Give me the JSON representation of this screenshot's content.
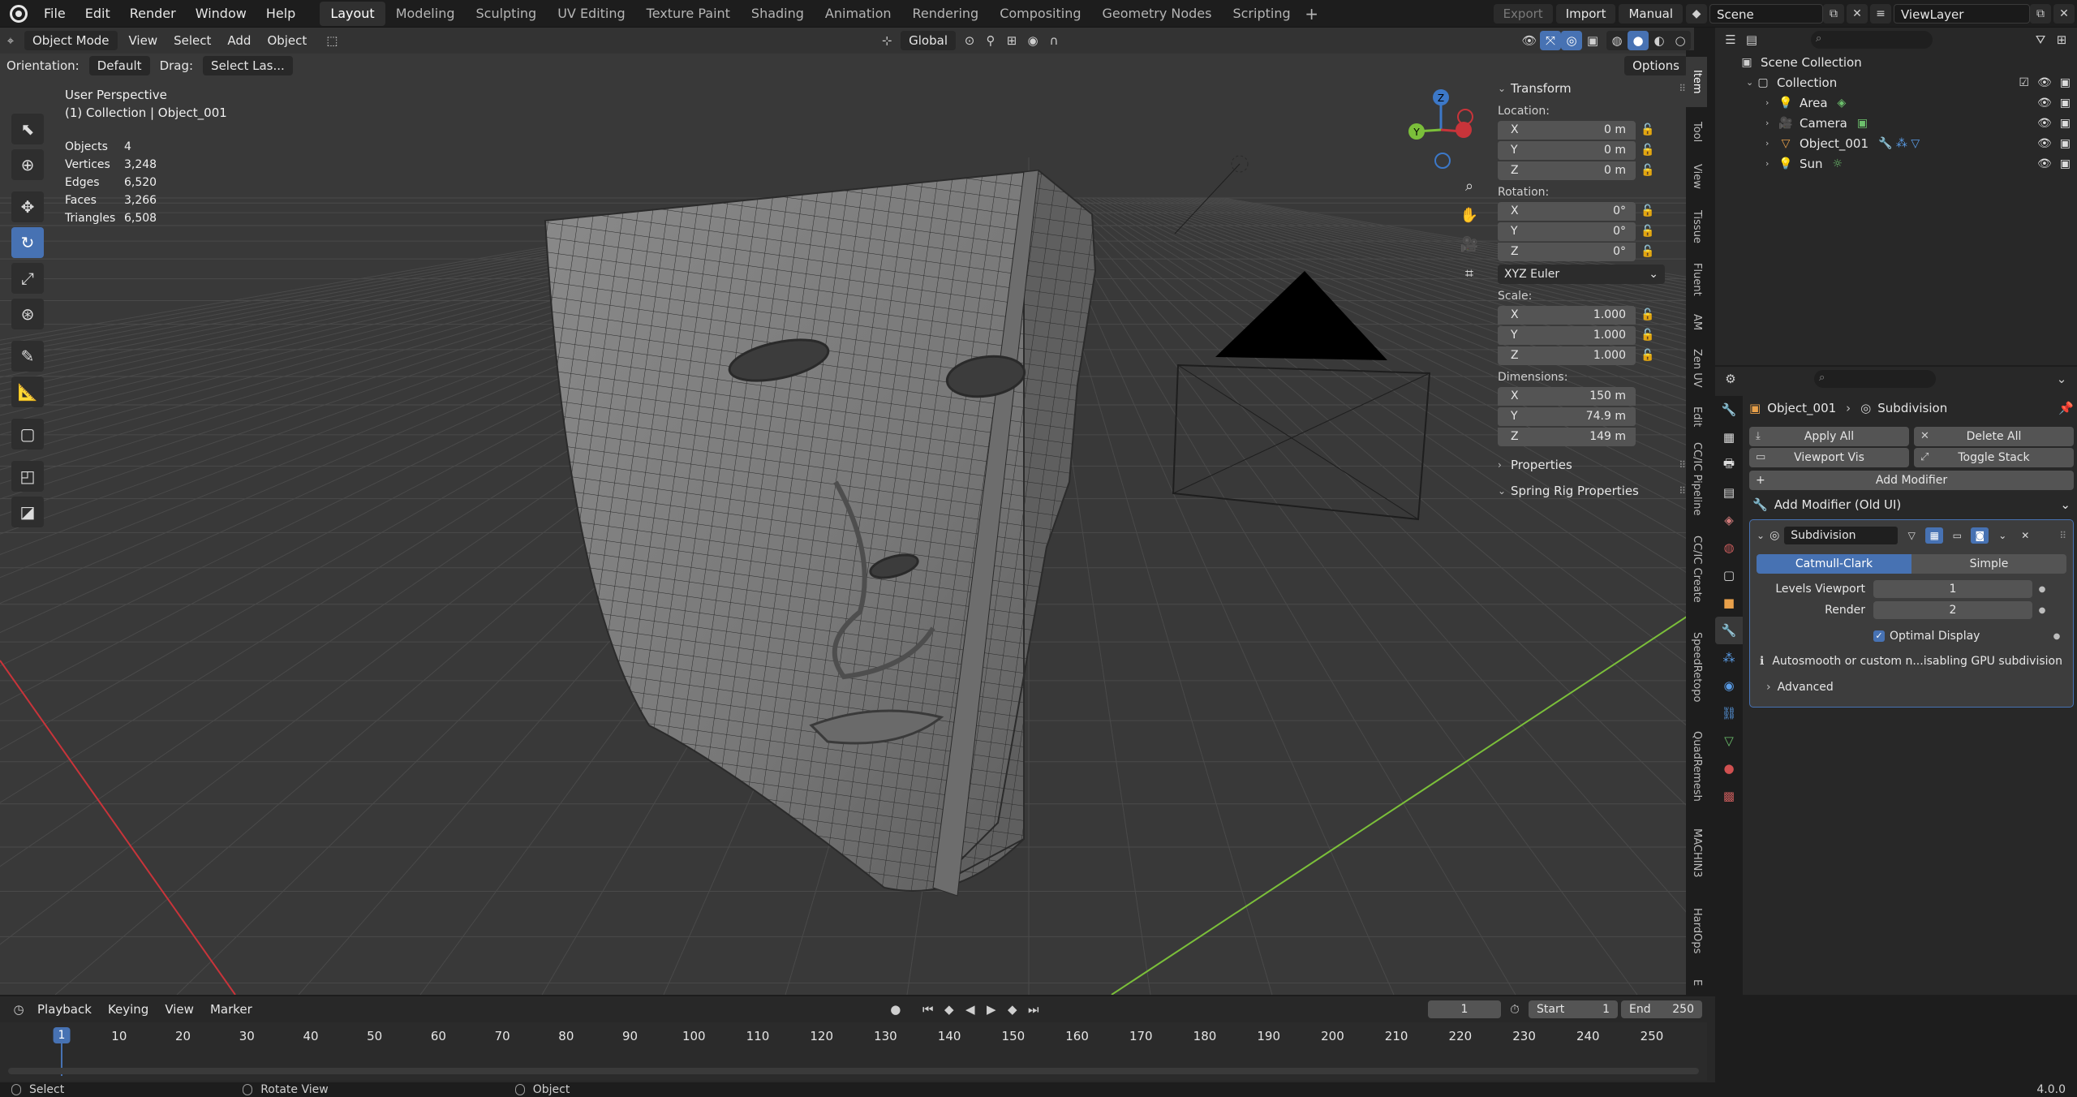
{
  "menu": [
    "File",
    "Edit",
    "Render",
    "Window",
    "Help"
  ],
  "workspaces": [
    "Layout",
    "Modeling",
    "Sculpting",
    "UV Editing",
    "Texture Paint",
    "Shading",
    "Animation",
    "Rendering",
    "Compositing",
    "Geometry Nodes",
    "Scripting"
  ],
  "active_workspace": "Layout",
  "topright": {
    "export": "Export",
    "import": "Import",
    "manual": "Manual",
    "scene": "Scene",
    "view_layer": "ViewLayer"
  },
  "viewport_header": {
    "mode": "Object Mode",
    "menus": [
      "View",
      "Select",
      "Add",
      "Object"
    ],
    "transform_orientation": "Global",
    "options": "Options",
    "orientation_label": "Orientation:",
    "orientation_value": "Default",
    "drag_label": "Drag:",
    "drag_value": "Select Las..."
  },
  "overlay": {
    "view_name": "User Perspective",
    "collection_line": "(1) Collection | Object_001",
    "stats": [
      {
        "k": "Objects",
        "v": "4"
      },
      {
        "k": "Vertices",
        "v": "3,248"
      },
      {
        "k": "Edges",
        "v": "6,520"
      },
      {
        "k": "Faces",
        "v": "3,266"
      },
      {
        "k": "Triangles",
        "v": "6,508"
      }
    ]
  },
  "gizmo": {
    "x": "X",
    "y": "Y",
    "z": "Z"
  },
  "npanel": {
    "transform": "Transform",
    "location_label": "Location:",
    "location": [
      {
        "a": "X",
        "v": "0 m"
      },
      {
        "a": "Y",
        "v": "0 m"
      },
      {
        "a": "Z",
        "v": "0 m"
      }
    ],
    "rotation_label": "Rotation:",
    "rotation": [
      {
        "a": "X",
        "v": "0°"
      },
      {
        "a": "Y",
        "v": "0°"
      },
      {
        "a": "Z",
        "v": "0°"
      }
    ],
    "rotation_mode": "XYZ Euler",
    "scale_label": "Scale:",
    "scale": [
      {
        "a": "X",
        "v": "1.000"
      },
      {
        "a": "Y",
        "v": "1.000"
      },
      {
        "a": "Z",
        "v": "1.000"
      }
    ],
    "dimensions_label": "Dimensions:",
    "dimensions": [
      {
        "a": "X",
        "v": "150 m"
      },
      {
        "a": "Y",
        "v": "74.9 m"
      },
      {
        "a": "Z",
        "v": "149 m"
      }
    ],
    "properties": "Properties",
    "spring_rig": "Spring Rig Properties"
  },
  "side_tabs": [
    "Item",
    "Tool",
    "View",
    "Tissue",
    "Fluent",
    "AM",
    "Zen UV",
    "Edit",
    "CC/IC Pipeline",
    "CC/IC Create",
    "SpeedRetopo",
    "QuadRemesh",
    "MACHIN3",
    "HardOps",
    "E"
  ],
  "outliner": {
    "scene_collection": "Scene Collection",
    "collection": "Collection",
    "items": [
      "Area",
      "Camera",
      "Object_001",
      "Sun"
    ]
  },
  "properties": {
    "object": "Object_001",
    "modifier_crumb": "Subdivision",
    "apply_all": "Apply All",
    "delete_all": "Delete All",
    "viewport_vis": "Viewport Vis",
    "toggle_stack": "Toggle Stack",
    "add_modifier": "Add Modifier",
    "add_modifier_old": "Add Modifier (Old UI)",
    "modifier_name": "Subdivision",
    "catmull": "Catmull-Clark",
    "simple": "Simple",
    "levels_viewport_label": "Levels Viewport",
    "levels_viewport": "1",
    "render_label": "Render",
    "render": "2",
    "optimal_display": "Optimal Display",
    "warning": "Autosmooth or custom n...isabling GPU subdivision",
    "advanced": "Advanced"
  },
  "timeline": {
    "menus": [
      "Playback",
      "Keying",
      "View",
      "Marker"
    ],
    "current_frame": "1",
    "start_label": "Start",
    "start": "1",
    "end_label": "End",
    "end": "250",
    "ruler": [
      "1",
      "10",
      "20",
      "30",
      "40",
      "50",
      "60",
      "70",
      "80",
      "90",
      "100",
      "110",
      "120",
      "130",
      "140",
      "150",
      "160",
      "170",
      "180",
      "190",
      "200",
      "210",
      "220",
      "230",
      "240",
      "250"
    ]
  },
  "statusbar": {
    "select": "Select",
    "rotate": "Rotate View",
    "object": "Object",
    "version": "4.0.0"
  },
  "colors": {
    "accent": "#4772b3",
    "viewport_bg": "#393939",
    "x_axis": "#c8343a",
    "y_axis": "#7bbf3a",
    "z_axis": "#3c78c8"
  }
}
